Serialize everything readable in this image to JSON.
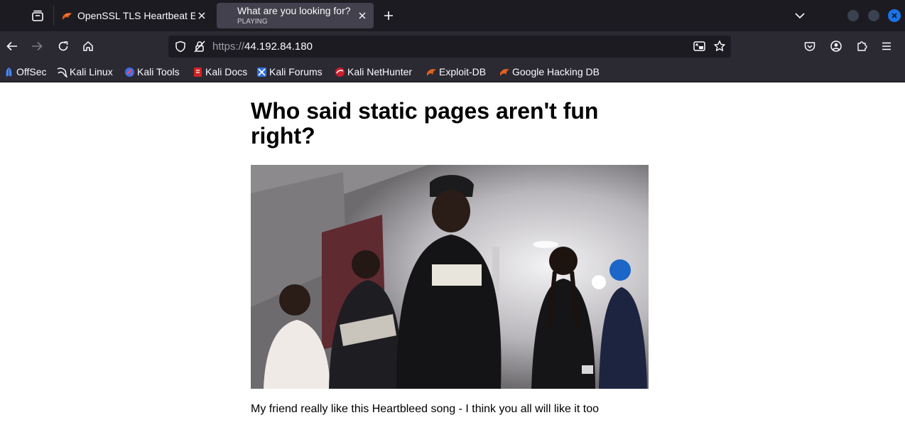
{
  "browser": {
    "tabs": [
      {
        "title": "OpenSSL TLS Heartbeat E",
        "active": false
      },
      {
        "title": "What are you looking for?",
        "status": "PLAYING",
        "active": true
      }
    ],
    "url": {
      "protocol": "https://",
      "host": "44.192.84.180"
    },
    "bookmarks": [
      {
        "label": "OffSec",
        "icon": "offsec-icon"
      },
      {
        "label": "Kali Linux",
        "icon": "kali-dragon-icon"
      },
      {
        "label": "Kali Tools",
        "icon": "kali-tools-icon"
      },
      {
        "label": "Kali Docs",
        "icon": "kali-docs-icon"
      },
      {
        "label": "Kali Forums",
        "icon": "kali-forums-icon"
      },
      {
        "label": "Kali NetHunter",
        "icon": "nethunter-icon"
      },
      {
        "label": "Exploit-DB",
        "icon": "exploit-db-icon"
      },
      {
        "label": "Google Hacking DB",
        "icon": "ghdb-icon"
      }
    ],
    "colors": {
      "tabbar": "#1c1b22",
      "toolbar": "#2b2a33",
      "urlbar": "#1c1b22",
      "accent_close": "#1a73e8"
    }
  },
  "page": {
    "heading": "Who said static pages aren't fun right?",
    "paragraph": "My friend really like this Heartbleed song - I think you all will like it too"
  }
}
